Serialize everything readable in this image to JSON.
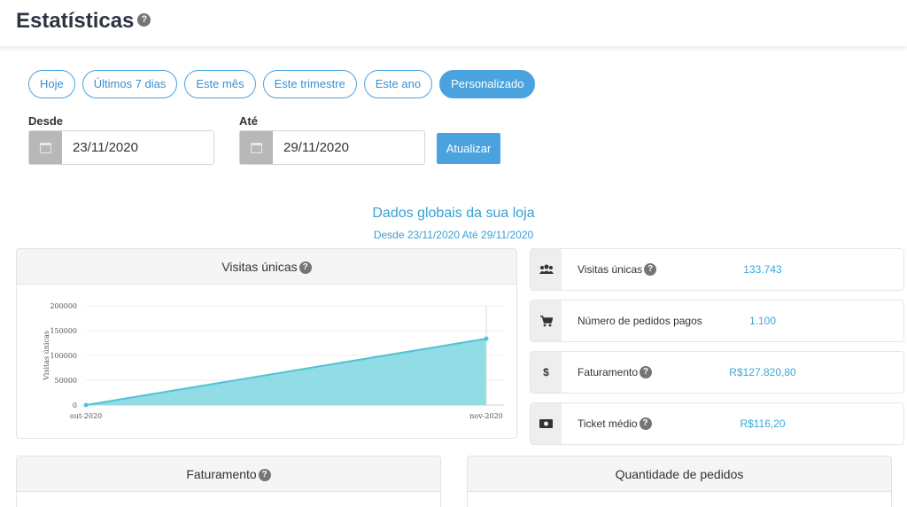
{
  "header": {
    "title": "Estatísticas",
    "help_glyph": "?"
  },
  "periods": [
    {
      "label": "Hoje",
      "active": false
    },
    {
      "label": "Últimos 7 dias",
      "active": false
    },
    {
      "label": "Este mês",
      "active": false
    },
    {
      "label": "Este trimestre",
      "active": false
    },
    {
      "label": "Este ano",
      "active": false
    },
    {
      "label": "Personalizado",
      "active": true
    }
  ],
  "filters": {
    "from_label": "Desde",
    "from_value": "23/11/2020",
    "to_label": "Até",
    "to_value": "29/11/2020",
    "update_label": "Atualizar"
  },
  "summary": {
    "title": "Dados globais da sua loja",
    "subtitle": "Desde 23/11/2020 Até 29/11/2020"
  },
  "visits_panel": {
    "title": "Visitas únicas"
  },
  "stats": [
    {
      "icon": "users-icon",
      "label": "Visitas únicas",
      "value": "133.743",
      "help": true
    },
    {
      "icon": "cart-icon",
      "label": "Número de pedidos pagos",
      "value": "1.100",
      "help": false
    },
    {
      "icon": "dollar-icon",
      "label": "Faturamento",
      "value": "R$127.820,80",
      "help": true,
      "icon_text": "$"
    },
    {
      "icon": "money-icon",
      "label": "Ticket médio",
      "value": "R$116,20",
      "help": true
    }
  ],
  "bottom_panels": {
    "revenue_title": "Faturamento",
    "orders_title": "Quantidade de pedidos"
  },
  "chart_data": {
    "type": "area",
    "categories": [
      "out-2020",
      "nov-2020"
    ],
    "series": [
      {
        "values": [
          0,
          133743
        ]
      }
    ],
    "ylabel": "Visitas únicas",
    "yticks": [
      "0",
      "50000",
      "100000",
      "150000",
      "200000"
    ],
    "ylim": [
      0,
      200000
    ],
    "grid": true,
    "color": "#7fd6e0",
    "line_color": "#4fc3d6"
  }
}
